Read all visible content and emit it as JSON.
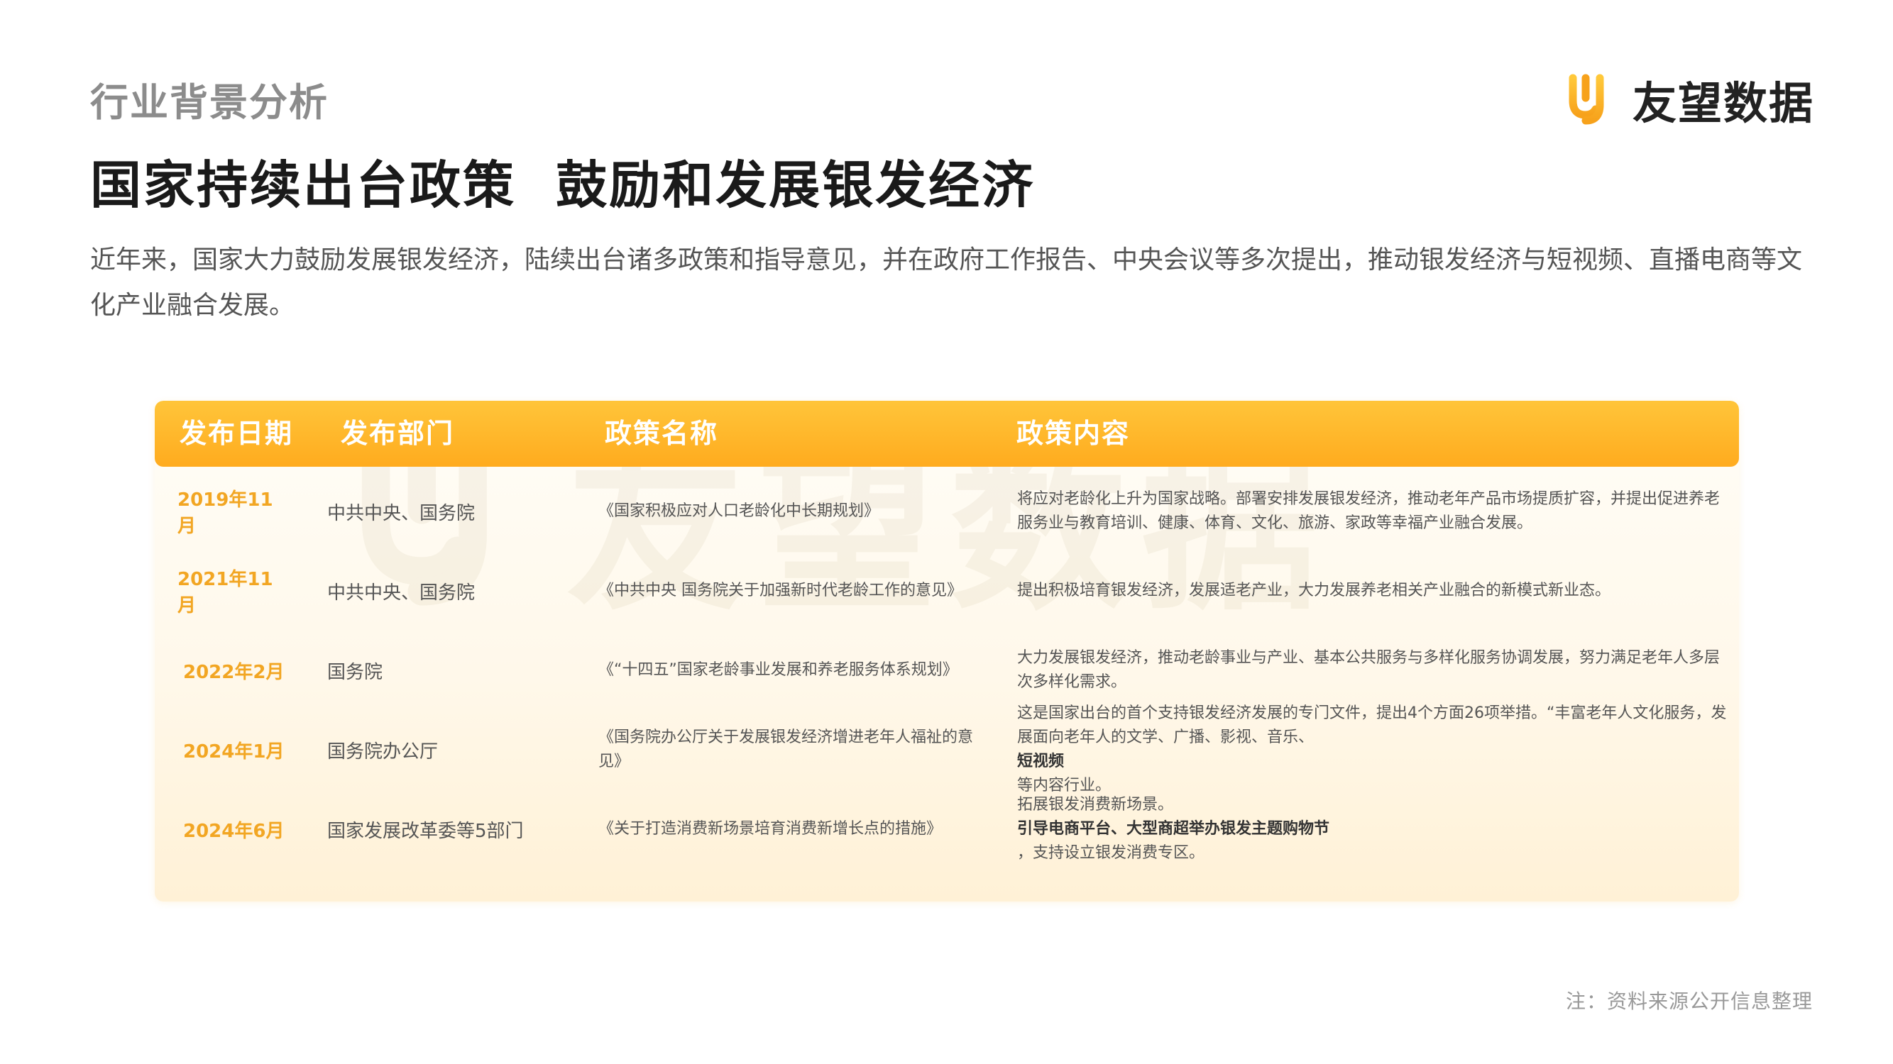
{
  "header": {
    "section_label": "行业背景分析",
    "brand_name": "友望数据",
    "brand_colors": {
      "orange": "#f7a21b",
      "yellow": "#ffc83a"
    },
    "logo_icon": "uw-logo-icon"
  },
  "title": "国家持续出台政策  鼓励和发展银发经济",
  "intro": "近年来，国家大力鼓励发展银发经济，陆续出台诸多政策和指导意见，并在政府工作报告、中央会议等多次提出，推动银发经济与短视频、直播电商等文化产业融合发展。",
  "table": {
    "headers": [
      "发布日期",
      "发布部门",
      "政策名称",
      "政策内容"
    ],
    "header_color": "#ffb124",
    "watermark": "友望数据",
    "rows": [
      {
        "date": "2019年11月",
        "dept": "中共中央、国务院",
        "name": "《国家积极应对人口老龄化中长期规划》",
        "content": "将应对老龄化上升为国家战略。部署安排发展银发经济，推动老年产品市场提质扩容，并提出促进养老服务业与教育培训、健康、体育、文化、旅游、家政等幸福产业融合发展。"
      },
      {
        "date": "2021年11月",
        "dept": "中共中央、国务院",
        "name": "《中共中央 国务院关于加强新时代老龄工作的意见》",
        "content": "提出积极培育银发经济，发展适老产业，大力发展养老相关产业融合的新模式新业态。"
      },
      {
        "date": "2022年2月",
        "dept": "国务院",
        "name": "《“十四五”国家老龄事业发展和养老服务体系规划》",
        "content": "大力发展银发经济，推动老龄事业与产业、基本公共服务与多样化服务协调发展，努力满足老年人多层次多样化需求。"
      },
      {
        "date": "2024年1月",
        "dept": "国务院办公厅",
        "name": "《国务院办公厅关于发展银发经济增进老年人福祉的意见》",
        "content_pre": "这是国家出台的首个支持银发经济发展的专门文件，提出4个方面26项举措。“丰富老年人文化服务，发展面向老年人的文学、广播、影视、音乐、",
        "content_hl": "短视频",
        "content_post": "等内容行业。"
      },
      {
        "date": "2024年6月",
        "dept": "国家发展改革委等5部门",
        "name": "《关于打造消费新场景培育消费新增长点的措施》",
        "content_pre": "拓展银发消费新场景。",
        "content_hl": "引导电商平台、大型商超举办银发主题购物节",
        "content_post": "，支持设立银发消费专区。"
      }
    ]
  },
  "note": "注：资料来源公开信息整理"
}
